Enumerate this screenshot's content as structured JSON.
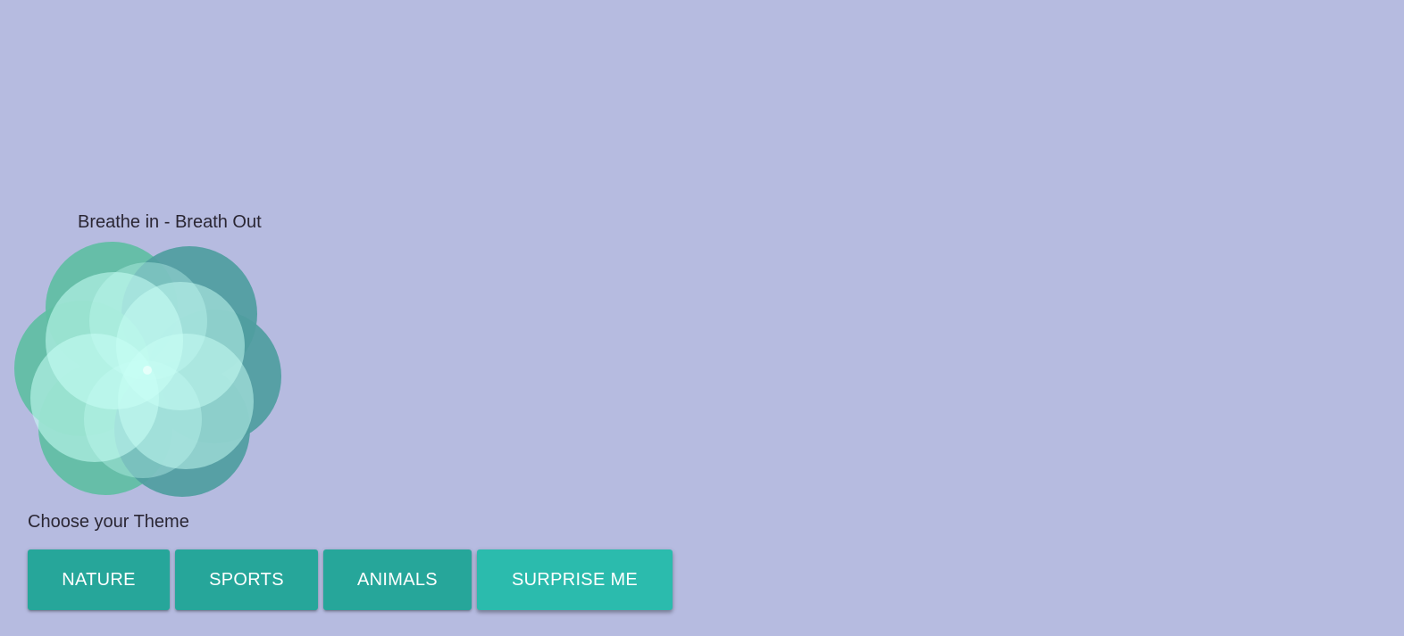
{
  "app": {
    "breathe_title": "Breathe in - Breath Out",
    "theme_label": "Choose your Theme"
  },
  "flower": {
    "icon": "breathing-flower",
    "colors": {
      "left_petals": "#5fbea3",
      "right_petals": "#4f9d9f",
      "overlap_left": "#a2ede0",
      "overlap_right": "#8adbdf",
      "center": "#c4fcf3"
    }
  },
  "themes": [
    {
      "label": "NATURE"
    },
    {
      "label": "SPORTS"
    },
    {
      "label": "ANIMALS"
    },
    {
      "label": "SURPRISE ME",
      "active": true
    }
  ],
  "colors": {
    "background": "#b6bbe0",
    "button": "#26a69a",
    "button_active": "#2bbbad",
    "button_text": "#ffffff",
    "text": "#2a2633"
  }
}
